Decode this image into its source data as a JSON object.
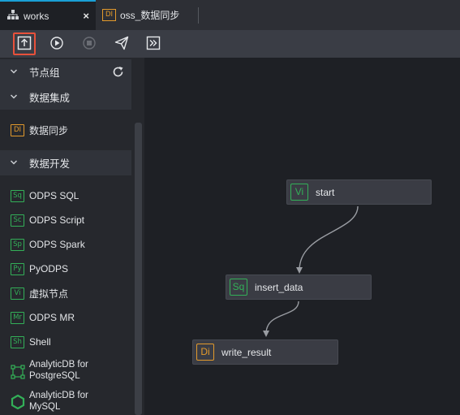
{
  "tabs": [
    {
      "title": "works",
      "icon": "sitemap-icon",
      "active": true,
      "close": "×"
    },
    {
      "title": "oss_数据同步",
      "icon_text": "DI"
    }
  ],
  "toolbar": {
    "buttons": [
      "submit-icon",
      "run-icon",
      "stop-icon",
      "publish-icon",
      "goto-ops-icon"
    ]
  },
  "sidebar": {
    "groups": [
      {
        "label": "节点组"
      },
      {
        "label": "数据集成"
      },
      {
        "label": "数据开发"
      }
    ],
    "integration_items": [
      {
        "badge": "DI",
        "label": "数据同步"
      }
    ],
    "dev_items": [
      {
        "badge": "Sq",
        "label": "ODPS SQL"
      },
      {
        "badge": "Sc",
        "label": "ODPS Script"
      },
      {
        "badge": "Sp",
        "label": "ODPS Spark"
      },
      {
        "badge": "Py",
        "label": "PyODPS"
      },
      {
        "badge": "Vi",
        "label": "虚拟节点"
      },
      {
        "badge": "Mr",
        "label": "ODPS MR"
      },
      {
        "badge": "Sh",
        "label": "Shell"
      },
      {
        "label_line1": "AnalyticDB for",
        "label_line2": "PostgreSQL"
      },
      {
        "label_line1": "AnalyticDB for",
        "label_line2": "MySQL"
      }
    ]
  },
  "canvas": {
    "nodes": [
      {
        "badge": "Vi",
        "label": "start"
      },
      {
        "badge": "Sq",
        "label": "insert_data"
      },
      {
        "badge": "Di",
        "label": "write_result"
      }
    ]
  },
  "colors": {
    "accent": "#1aa0d6",
    "highlight": "#e8513b",
    "green": "#33b058",
    "orange": "#e39a2c"
  }
}
